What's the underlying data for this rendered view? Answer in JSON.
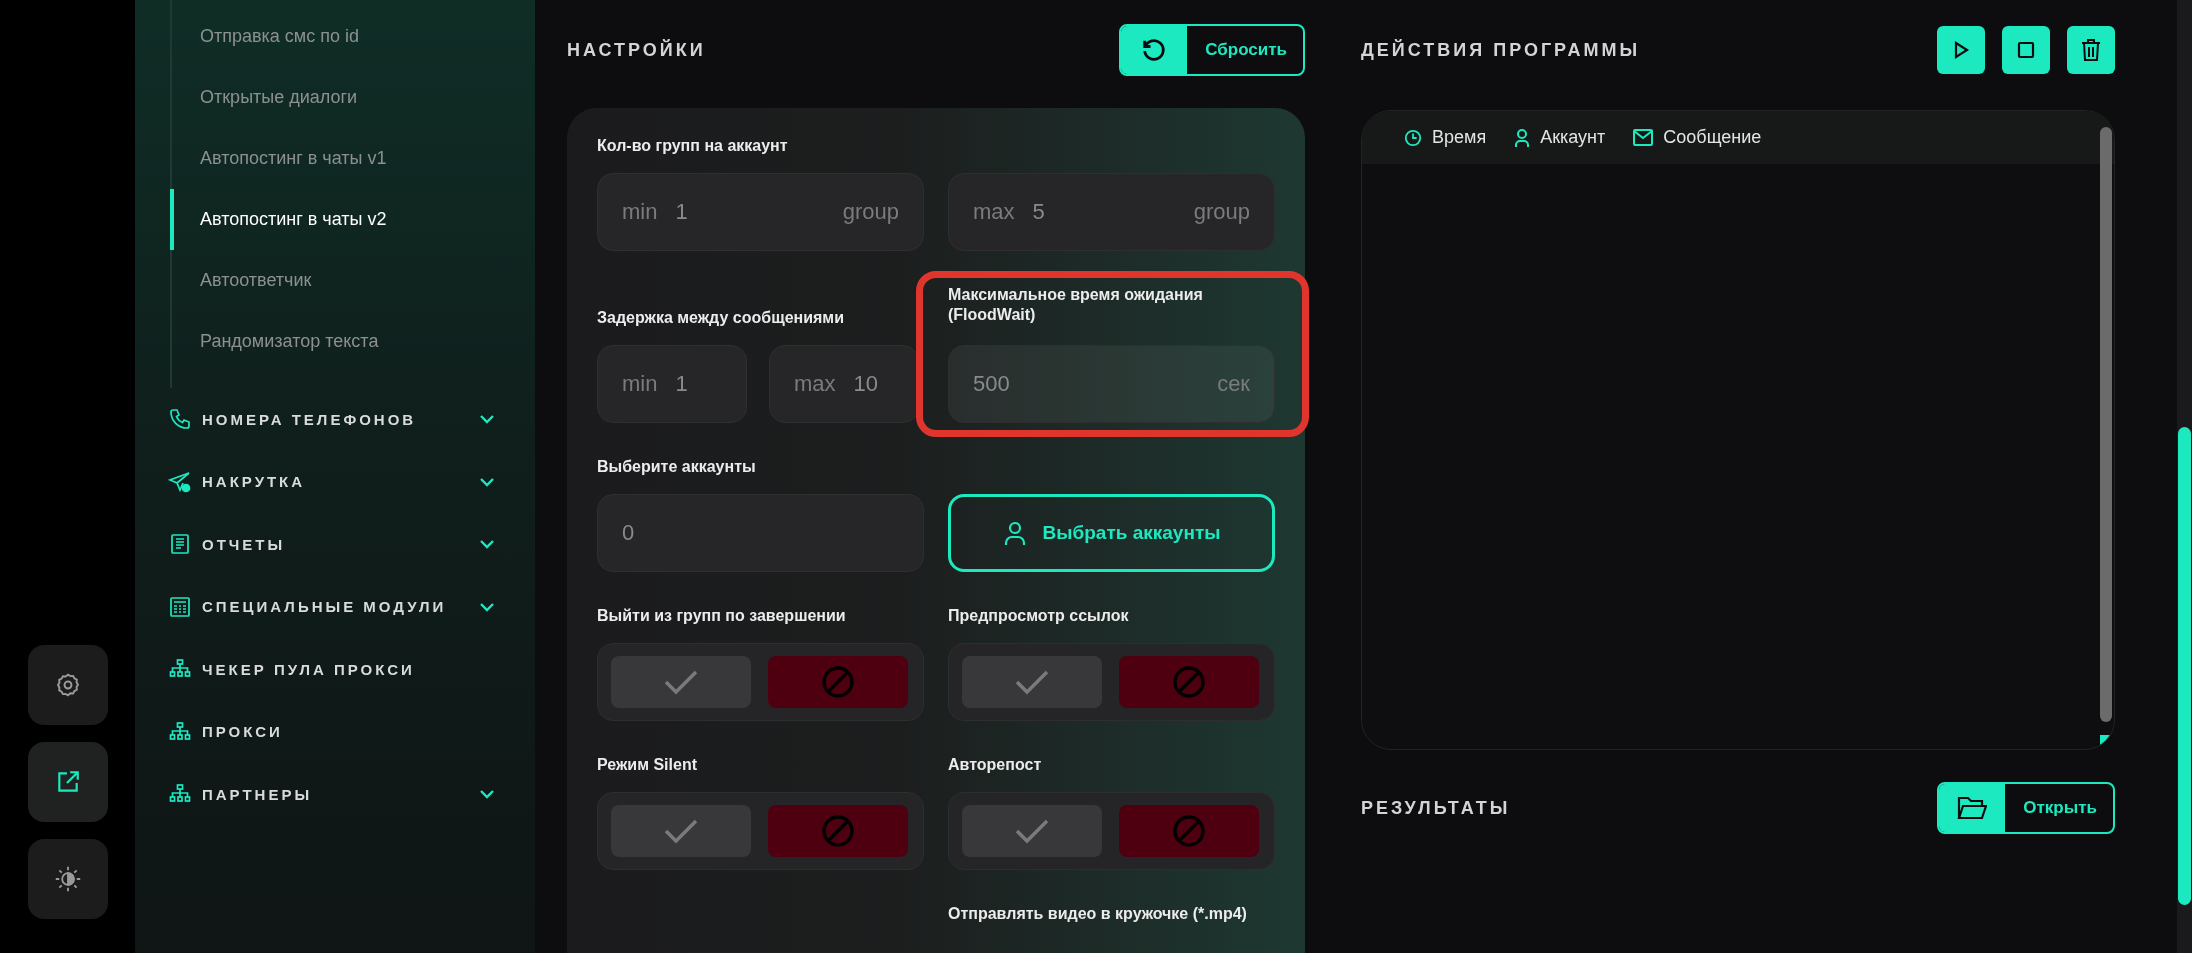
{
  "rail": [
    {
      "kind": "settings",
      "selected": false
    },
    {
      "kind": "share",
      "selected": true
    },
    {
      "kind": "theme",
      "selected": false
    }
  ],
  "sidebar": {
    "subitems": [
      {
        "label": "Отправка смс по id",
        "selected": false
      },
      {
        "label": "Открытые диалоги",
        "selected": false
      },
      {
        "label": "Автопостинг в чаты v1",
        "selected": false
      },
      {
        "label": "Автопостинг в чаты v2",
        "selected": true
      },
      {
        "label": "Автоответчик",
        "selected": false
      },
      {
        "label": "Рандомизатор текста",
        "selected": false
      }
    ],
    "sections": [
      {
        "label": "НОМЕРА ТЕЛЕФОНОВ",
        "kind": "phone",
        "expandable": true
      },
      {
        "label": "НАКРУТКА",
        "kind": "send",
        "expandable": true
      },
      {
        "label": "ОТЧЕТЫ",
        "kind": "report",
        "expandable": true
      },
      {
        "label": "СПЕЦИАЛЬНЫЕ МОДУЛИ",
        "kind": "calc",
        "expandable": true
      },
      {
        "label": "ЧЕКЕР ПУЛА ПРОКСИ",
        "kind": "network",
        "expandable": false
      },
      {
        "label": "ПРОКСИ",
        "kind": "network",
        "expandable": false
      },
      {
        "label": "ПАРТНЕРЫ",
        "kind": "network",
        "expandable": true
      }
    ]
  },
  "settings": {
    "title": "НАСТРОЙКИ",
    "reset_button": "Сбросить",
    "group_count": {
      "label": "Кол-во групп на аккаунт",
      "min": {
        "prefix": "min",
        "value": "1",
        "unit": "group"
      },
      "max": {
        "prefix": "max",
        "value": "5",
        "unit": "group"
      }
    },
    "delay": {
      "label": "Задержка между сообщениями",
      "min": {
        "prefix": "min",
        "value": "1"
      },
      "max": {
        "prefix": "max",
        "value": "10"
      }
    },
    "floodwait": {
      "label": "Максимальное время ожидания (FloodWait)",
      "value": "500",
      "unit": "сек",
      "highlighted": true
    },
    "accounts": {
      "label": "Выберите аккаунты",
      "value": "0",
      "button": "Выбрать аккаунты"
    },
    "toggles": [
      {
        "label": "Выйти из групп по завершении",
        "on": false
      },
      {
        "label": "Предпросмотр ссылок",
        "on": false
      },
      {
        "label": "Режим Silent",
        "on": false
      },
      {
        "label": "Авторепост",
        "on": false
      }
    ],
    "video_circle": {
      "label": "Отправлять видео в кружочке (*.mp4)"
    }
  },
  "actions": {
    "title": "ДЕЙСТВИЯ ПРОГРАММЫ",
    "buttons": [
      {
        "kind": "play"
      },
      {
        "kind": "stop"
      },
      {
        "kind": "delete"
      }
    ],
    "columns": [
      {
        "label": "Время",
        "kind": "clock"
      },
      {
        "label": "Аккаунт",
        "kind": "user"
      },
      {
        "label": "Сообщение",
        "kind": "mail"
      }
    ]
  },
  "results": {
    "title": "РЕЗУЛЬТАТЫ",
    "open_button": "Открыть"
  }
}
